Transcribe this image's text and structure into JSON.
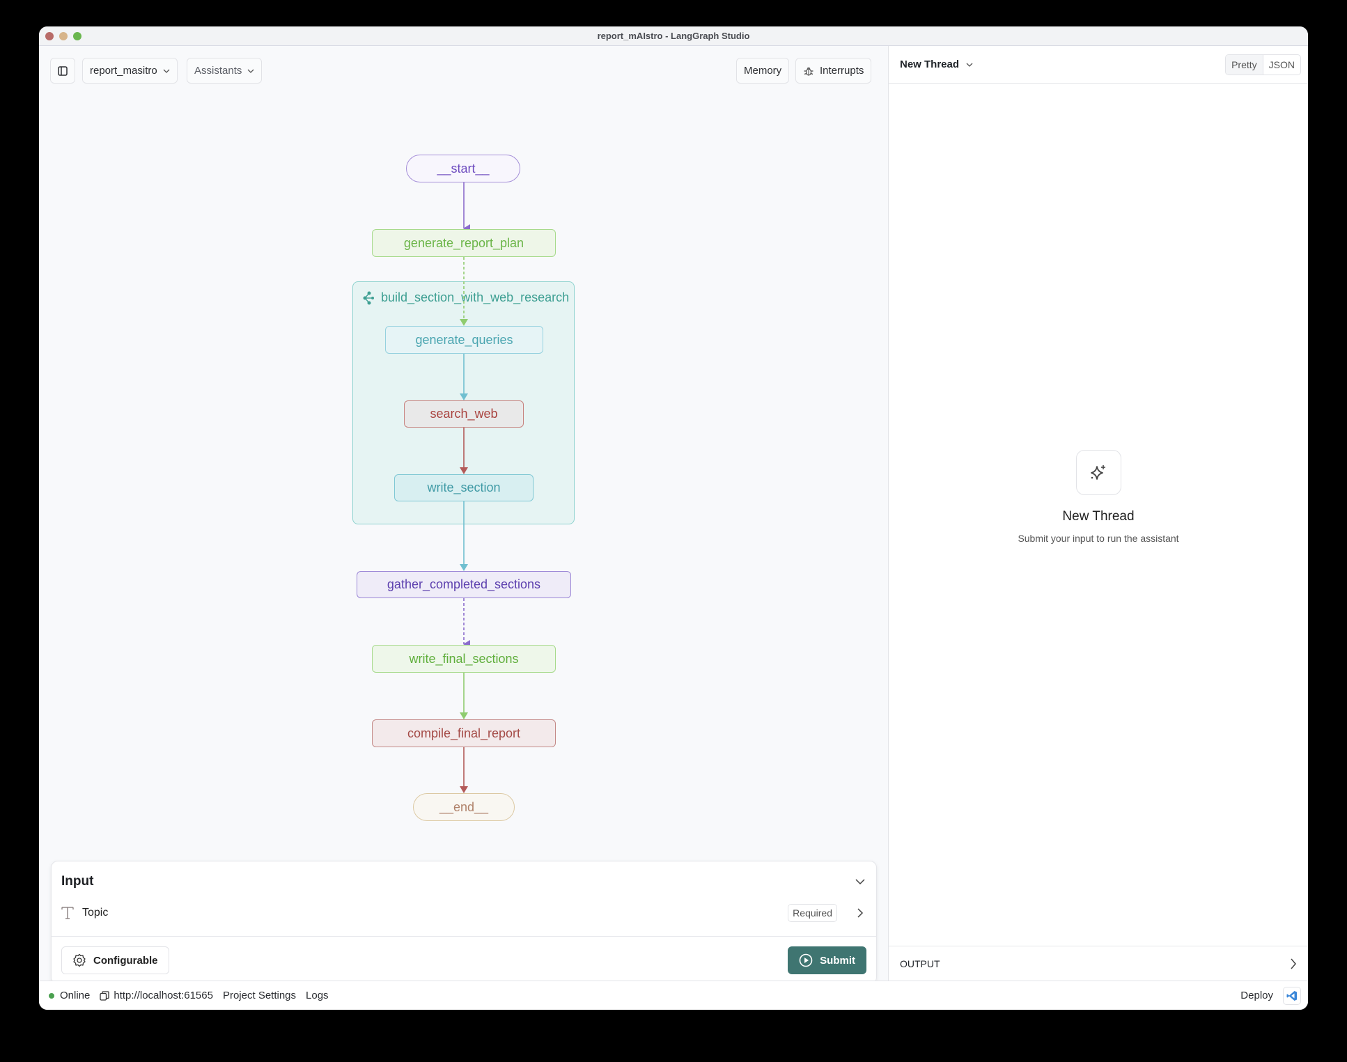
{
  "window": {
    "title": "report_mAIstro - LangGraph Studio"
  },
  "toolbar": {
    "graph_select": "report_masitro",
    "assistants_label": "Assistants",
    "memory_label": "Memory",
    "interrupts_label": "Interrupts"
  },
  "graph": {
    "nodes": {
      "start": "__start__",
      "generate_report_plan": "generate_report_plan",
      "subgraph": "build_section_with_web_research",
      "generate_queries": "generate_queries",
      "search_web": "search_web",
      "write_section": "write_section",
      "gather_completed_sections": "gather_completed_sections",
      "write_final_sections": "write_final_sections",
      "compile_final_report": "compile_final_report",
      "end": "__end__"
    },
    "colors": {
      "purple": "#8b6ccc",
      "green": "#8fcc6f",
      "teal": "#70bfd0",
      "red": "#b35a58",
      "beige": "#d6c199"
    }
  },
  "input_panel": {
    "title": "Input",
    "fields": [
      {
        "label": "Topic",
        "badge": "Required"
      }
    ],
    "configurable_label": "Configurable",
    "submit_label": "Submit"
  },
  "status_bar": {
    "status": "Online",
    "url": "http://localhost:61565",
    "project_settings": "Project Settings",
    "logs": "Logs",
    "deploy": "Deploy"
  },
  "thread_panel": {
    "thread_select": "New Thread",
    "view_modes": [
      "Pretty",
      "JSON"
    ],
    "active_view": "Pretty",
    "empty_title": "New Thread",
    "empty_subtitle": "Submit your input to run the assistant",
    "output_label": "OUTPUT"
  }
}
